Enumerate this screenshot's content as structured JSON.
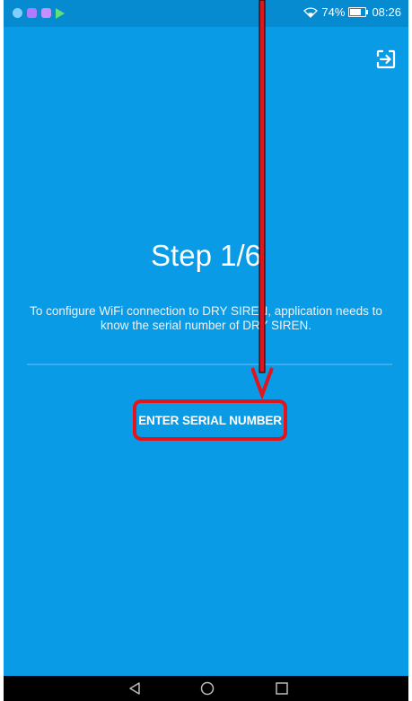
{
  "status_bar": {
    "battery_percent": "74%",
    "time": "08:26",
    "battery_level": 0.74,
    "icons": [
      "shield-app-icon",
      "chat-app-icon",
      "gallery-app-icon",
      "play-store-icon",
      "wifi-icon",
      "battery-icon"
    ]
  },
  "header": {
    "exit_icon": "exit-to-app-icon"
  },
  "main": {
    "step_title": "Step 1/6",
    "description": "To configure WiFi connection to DRY SIREN, application needs to know the serial number of DRY SIREN.",
    "enter_serial_button": "ENTER SERIAL NUMBER"
  },
  "colors": {
    "background": "#0a9be6",
    "status_bar": "#078bd0",
    "annotation": "#e2141c"
  },
  "nav_bar": {
    "icons": [
      "back-icon",
      "home-icon",
      "recent-apps-icon"
    ]
  }
}
